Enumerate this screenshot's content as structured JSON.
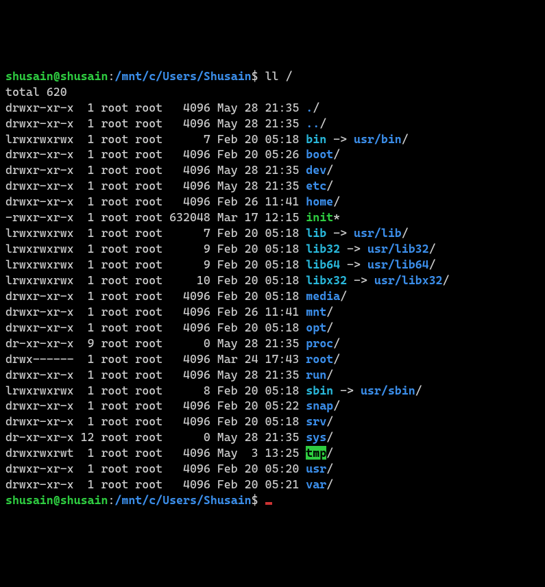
{
  "prompt": {
    "user": "shusain",
    "host": "shusain",
    "cwd": "/mnt/c/Users/Shusain",
    "sep_uh": "@",
    "sep_hp": ":",
    "sigil": "$",
    "command": "ll /"
  },
  "total_line": "total 620",
  "rows": [
    {
      "perm": "drwxr-xr-x",
      "links": "1",
      "owner": "root",
      "group": "root",
      "size": "4096",
      "date": "May 28 21:35",
      "name": ".",
      "type": "dir"
    },
    {
      "perm": "drwxr-xr-x",
      "links": "1",
      "owner": "root",
      "group": "root",
      "size": "4096",
      "date": "May 28 21:35",
      "name": "..",
      "type": "dir"
    },
    {
      "perm": "lrwxrwxrwx",
      "links": "1",
      "owner": "root",
      "group": "root",
      "size": "7",
      "date": "Feb 20 05:18",
      "name": "bin",
      "type": "link",
      "target": "usr/bin/"
    },
    {
      "perm": "drwxr-xr-x",
      "links": "1",
      "owner": "root",
      "group": "root",
      "size": "4096",
      "date": "Feb 20 05:26",
      "name": "boot",
      "type": "dir"
    },
    {
      "perm": "drwxr-xr-x",
      "links": "1",
      "owner": "root",
      "group": "root",
      "size": "4096",
      "date": "May 28 21:35",
      "name": "dev",
      "type": "dir"
    },
    {
      "perm": "drwxr-xr-x",
      "links": "1",
      "owner": "root",
      "group": "root",
      "size": "4096",
      "date": "May 28 21:35",
      "name": "etc",
      "type": "dir"
    },
    {
      "perm": "drwxr-xr-x",
      "links": "1",
      "owner": "root",
      "group": "root",
      "size": "4096",
      "date": "Feb 26 11:41",
      "name": "home",
      "type": "dir"
    },
    {
      "perm": "-rwxr-xr-x",
      "links": "1",
      "owner": "root",
      "group": "root",
      "size": "632048",
      "date": "Mar 17 12:15",
      "name": "init",
      "type": "exec"
    },
    {
      "perm": "lrwxrwxrwx",
      "links": "1",
      "owner": "root",
      "group": "root",
      "size": "7",
      "date": "Feb 20 05:18",
      "name": "lib",
      "type": "link",
      "target": "usr/lib/"
    },
    {
      "perm": "lrwxrwxrwx",
      "links": "1",
      "owner": "root",
      "group": "root",
      "size": "9",
      "date": "Feb 20 05:18",
      "name": "lib32",
      "type": "link",
      "target": "usr/lib32/"
    },
    {
      "perm": "lrwxrwxrwx",
      "links": "1",
      "owner": "root",
      "group": "root",
      "size": "9",
      "date": "Feb 20 05:18",
      "name": "lib64",
      "type": "link",
      "target": "usr/lib64/"
    },
    {
      "perm": "lrwxrwxrwx",
      "links": "1",
      "owner": "root",
      "group": "root",
      "size": "10",
      "date": "Feb 20 05:18",
      "name": "libx32",
      "type": "link",
      "target": "usr/libx32/"
    },
    {
      "perm": "drwxr-xr-x",
      "links": "1",
      "owner": "root",
      "group": "root",
      "size": "4096",
      "date": "Feb 20 05:18",
      "name": "media",
      "type": "dir"
    },
    {
      "perm": "drwxr-xr-x",
      "links": "1",
      "owner": "root",
      "group": "root",
      "size": "4096",
      "date": "Feb 26 11:41",
      "name": "mnt",
      "type": "dir"
    },
    {
      "perm": "drwxr-xr-x",
      "links": "1",
      "owner": "root",
      "group": "root",
      "size": "4096",
      "date": "Feb 20 05:18",
      "name": "opt",
      "type": "dir"
    },
    {
      "perm": "dr-xr-xr-x",
      "links": "9",
      "owner": "root",
      "group": "root",
      "size": "0",
      "date": "May 28 21:35",
      "name": "proc",
      "type": "dir"
    },
    {
      "perm": "drwx------",
      "links": "1",
      "owner": "root",
      "group": "root",
      "size": "4096",
      "date": "Mar 24 17:43",
      "name": "root",
      "type": "dir"
    },
    {
      "perm": "drwxr-xr-x",
      "links": "1",
      "owner": "root",
      "group": "root",
      "size": "4096",
      "date": "May 28 21:35",
      "name": "run",
      "type": "dir"
    },
    {
      "perm": "lrwxrwxrwx",
      "links": "1",
      "owner": "root",
      "group": "root",
      "size": "8",
      "date": "Feb 20 05:18",
      "name": "sbin",
      "type": "link",
      "target": "usr/sbin/"
    },
    {
      "perm": "drwxr-xr-x",
      "links": "1",
      "owner": "root",
      "group": "root",
      "size": "4096",
      "date": "Feb 20 05:22",
      "name": "snap",
      "type": "dir"
    },
    {
      "perm": "drwxr-xr-x",
      "links": "1",
      "owner": "root",
      "group": "root",
      "size": "4096",
      "date": "Feb 20 05:18",
      "name": "srv",
      "type": "dir"
    },
    {
      "perm": "dr-xr-xr-x",
      "links": "12",
      "owner": "root",
      "group": "root",
      "size": "0",
      "date": "May 28 21:35",
      "name": "sys",
      "type": "dir"
    },
    {
      "perm": "drwxrwxrwt",
      "links": "1",
      "owner": "root",
      "group": "root",
      "size": "4096",
      "date": "May  3 13:25",
      "name": "tmp",
      "type": "tmp"
    },
    {
      "perm": "drwxr-xr-x",
      "links": "1",
      "owner": "root",
      "group": "root",
      "size": "4096",
      "date": "Feb 20 05:20",
      "name": "usr",
      "type": "dir"
    },
    {
      "perm": "drwxr-xr-x",
      "links": "1",
      "owner": "root",
      "group": "root",
      "size": "4096",
      "date": "Feb 20 05:21",
      "name": "var",
      "type": "dir"
    }
  ],
  "arrow_text": " -> "
}
